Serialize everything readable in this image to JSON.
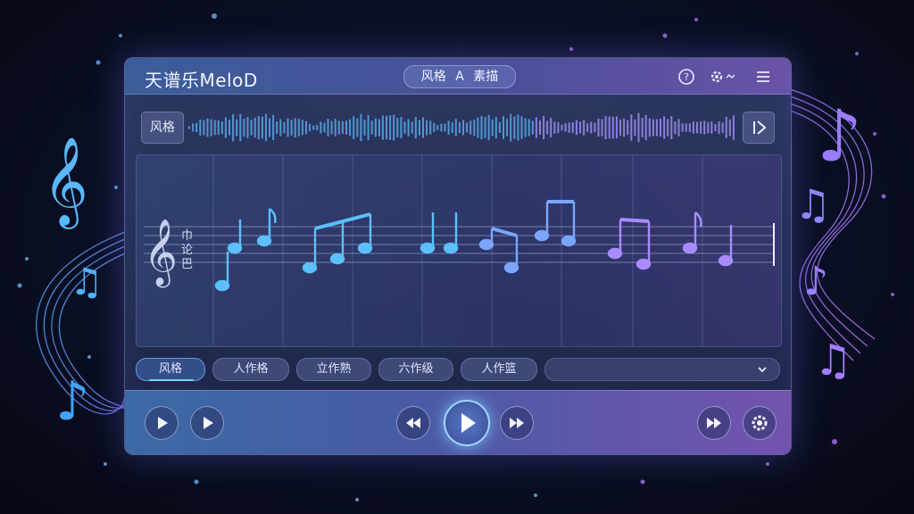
{
  "app": {
    "title": "天谱乐MeloD"
  },
  "header": {
    "pill": [
      "风格",
      "A",
      "素描"
    ]
  },
  "title_icons": [
    "help-icon",
    "settings-icon",
    "menu-icon"
  ],
  "waveform": {
    "style_label": "风格",
    "skip_icon": "skip-forward-icon"
  },
  "score": {
    "clef_icon": "treble-clef-icon",
    "clef_text": [
      "巾",
      "论",
      "巴"
    ]
  },
  "tabs": [
    {
      "label": "风格",
      "active": true
    },
    {
      "label": "人作格",
      "active": false
    },
    {
      "label": "立作熟",
      "active": false
    },
    {
      "label": "六作级",
      "active": false
    },
    {
      "label": "人作篮",
      "active": false
    }
  ],
  "dropdown": {
    "icon": "chevron-down-icon"
  },
  "transport": {
    "left": [
      "play-icon",
      "play-icon"
    ],
    "center": [
      "rewind-icon",
      "play-icon",
      "fast-forward-icon"
    ],
    "right": [
      "fast-forward-icon",
      "settings-icon"
    ]
  },
  "colors": {
    "accent": "#6fd0ff",
    "purple": "#b07aff",
    "bg": "#0a0f24"
  }
}
